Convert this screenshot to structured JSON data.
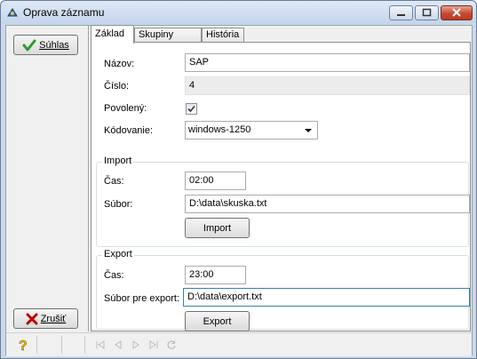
{
  "window": {
    "title": "Oprava záznamu"
  },
  "left": {
    "confirm_label": "Súhlas",
    "cancel_label": "Zrušiť"
  },
  "tabs": [
    {
      "label": "Základ",
      "active": true
    },
    {
      "label": "Skupiny hostí",
      "active": false
    },
    {
      "label": "História",
      "active": false
    }
  ],
  "basic": {
    "name_label": "Názov:",
    "name_value": "SAP",
    "number_label": "Číslo:",
    "number_value": "4",
    "enabled_label": "Povolený:",
    "enabled_checked": true,
    "encoding_label": "Kódovanie:",
    "encoding_value": "windows-1250"
  },
  "import": {
    "group_title": "Import",
    "time_label": "Čas:",
    "time_value": "02:00",
    "file_label": "Súbor:",
    "file_value": "D:\\data\\skuska.txt",
    "button_label": "Import"
  },
  "export": {
    "group_title": "Export",
    "time_label": "Čas:",
    "time_value": "23:00",
    "file_label": "Súbor pre export:",
    "file_value": "D:\\data\\export.txt",
    "button_label": "Export"
  },
  "colors": {
    "titlebar": "#c9d9ee",
    "close": "#c54a33",
    "check": "#2c9a2c",
    "cancel": "#c00000",
    "help": "#e8c000"
  }
}
